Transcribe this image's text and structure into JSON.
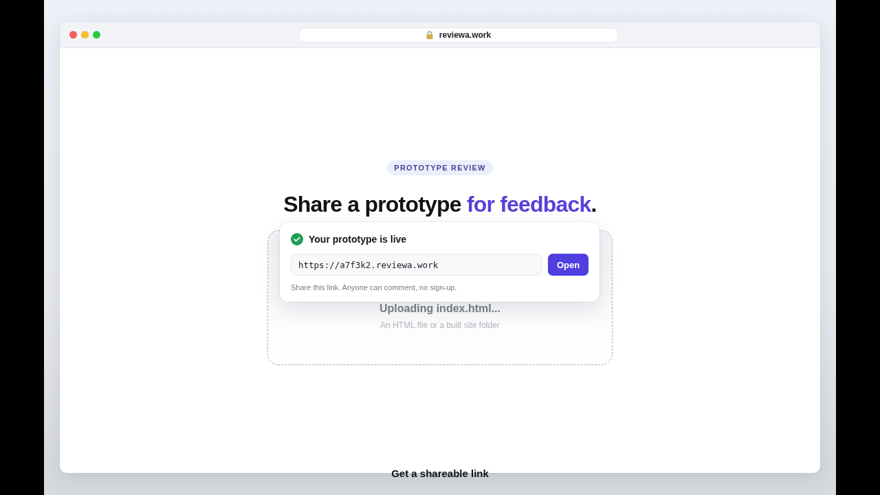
{
  "window": {
    "url": "reviewa.work"
  },
  "badge": "PROTOTYPE REVIEW",
  "headline": [
    {
      "text": "Share a prototype ",
      "highlighted": false
    },
    {
      "text": "for feedback",
      "highlighted": true
    },
    {
      "text": ".",
      "highlighted": false
    }
  ],
  "upload": {
    "status": "Uploading index.html...",
    "hint": "An HTML file or a built site folder"
  },
  "share_card": {
    "title": "Your prototype is live",
    "link": "https://a7f3k2.reviewa.work",
    "button": "Open",
    "note": "Share this link. Anyone can comment, no sign-up."
  },
  "caption": "Get a shareable link"
}
